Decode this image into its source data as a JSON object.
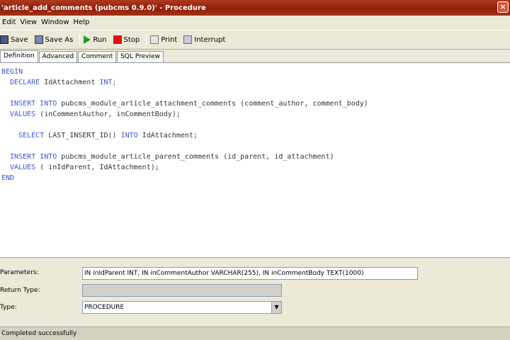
{
  "window": {
    "title": "'article_add_comments (pubcms 0.9.0)' - Procedure",
    "close_glyph": "×"
  },
  "menu": {
    "items": [
      "Edit",
      "View",
      "Window",
      "Help"
    ]
  },
  "toolbar": {
    "save_label": "Save",
    "saveas_label": "Save As",
    "run_label": "Run",
    "stop_label": "Stop",
    "print_label": "Print",
    "interrupt_label": "Interrupt"
  },
  "tabs": [
    "Definition",
    "Advanced",
    "Comment",
    "SQL Preview"
  ],
  "editor": {
    "lines": [
      [
        {
          "t": "BEGIN",
          "k": true
        }
      ],
      [
        {
          "t": "  DECLARE ",
          "k": true
        },
        {
          "t": "IdAttachment ",
          "k": false
        },
        {
          "t": "INT;",
          "k": true
        }
      ],
      [],
      [
        {
          "t": "  INSERT INTO ",
          "k": true
        },
        {
          "t": "pubcms_module_article_attachment_comments (comment_author, comment_body)",
          "k": false
        }
      ],
      [
        {
          "t": "  VALUES ",
          "k": true
        },
        {
          "t": "(inCommentAuthor, inCommentBody);",
          "k": false
        }
      ],
      [],
      [
        {
          "t": "    SELECT ",
          "k": true
        },
        {
          "t": "LAST_INSERT_ID() ",
          "k": false
        },
        {
          "t": "INTO ",
          "k": true
        },
        {
          "t": "IdAttachment;",
          "k": false
        }
      ],
      [],
      [
        {
          "t": "  INSERT INTO ",
          "k": true
        },
        {
          "t": "pubcms_module_article_parent_comments (id_parent, id_attachment)",
          "k": false
        }
      ],
      [
        {
          "t": "  VALUES ",
          "k": true
        },
        {
          "t": "( inIdParent, IdAttachment);",
          "k": false
        }
      ],
      [
        {
          "t": "END",
          "k": true
        }
      ]
    ]
  },
  "props": {
    "parameters_label": "Parameters:",
    "parameters_value": "IN inIdParent INT, IN inCommentAuthor VARCHAR(255), IN inCommentBody TEXT(1000)",
    "return_label": "Return Type:",
    "return_value": "",
    "type_label": "Type:",
    "type_value": "PROCEDURE"
  },
  "status": {
    "text": "Completed successfully"
  },
  "icons": {
    "close": "close-icon",
    "save": "save-icon",
    "saveas": "save-as-icon",
    "run": "run-icon",
    "stop": "stop-icon",
    "print": "print-icon",
    "interrupt": "interrupt-icon",
    "dropdown": "chevron-down-icon"
  },
  "colors": {
    "titlebar": "#a5341a",
    "keyword": "#3a55d8",
    "run_icon": "#1f9d1f",
    "stop_icon": "#dd1111"
  }
}
